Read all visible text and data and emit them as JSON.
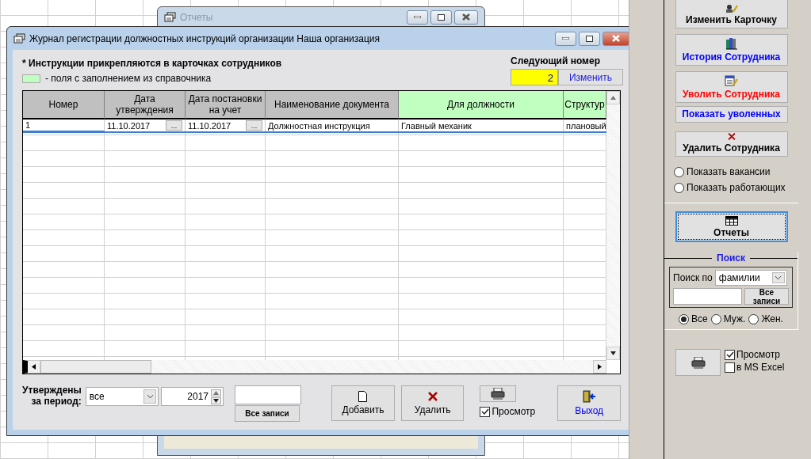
{
  "background_window": {
    "title": "Отчеты"
  },
  "window": {
    "title": "Журнал регистрации должностных инструкций организации  Наша организация",
    "note": "* Инструкции прикрепляются в карточках сотрудников",
    "legend": "- поля с заполнением из справочника",
    "next_number": {
      "label": "Следующий номер",
      "value": "2",
      "button": "Изменить"
    },
    "table": {
      "columns": [
        {
          "label": "Номер",
          "lookup": false
        },
        {
          "label": "Дата утверждения",
          "lookup": false
        },
        {
          "label": "Дата постановки на учет",
          "lookup": false
        },
        {
          "label": "Наименование документа",
          "lookup": false
        },
        {
          "label": "Для должности",
          "lookup": true
        },
        {
          "label": "Структур",
          "lookup": true
        }
      ],
      "rows": [
        {
          "selected": true,
          "cells": [
            {
              "kind": "text",
              "value": "1"
            },
            {
              "kind": "date",
              "value": "11.10.2017",
              "picker": "..."
            },
            {
              "kind": "date",
              "value": "11.10.2017",
              "picker": "..."
            },
            {
              "kind": "text",
              "value": "Должностная инструкция"
            },
            {
              "kind": "text",
              "value": "Главный механик"
            },
            {
              "kind": "text",
              "value": "плановый"
            }
          ]
        }
      ]
    },
    "filter": {
      "label": "Утверждены за период:",
      "period": "все",
      "year": "2017",
      "all_button": "Все записи"
    },
    "buttons": [
      {
        "kind": "add",
        "label": "Добавить"
      },
      {
        "kind": "delete",
        "label": "Удалить"
      },
      {
        "kind": "print",
        "preview": {
          "label": "Просмотр",
          "checked": true
        }
      },
      {
        "kind": "exit",
        "label": "Выход"
      }
    ]
  },
  "sidebar": {
    "buttons": [
      {
        "kind": "edit",
        "label": "Изменить Карточку",
        "color": "#000000"
      },
      {
        "kind": "history",
        "label": "История Сотрудника",
        "color": "#0000ff"
      },
      {
        "kind": "dismiss",
        "label": "Уволить Сотрудника",
        "color": "#ff0000"
      },
      {
        "kind": "plain",
        "label": "Показать уволенных",
        "color": "#0000ff"
      },
      {
        "kind": "delete",
        "label": "Удалить Сотрудника",
        "color": "#000000"
      }
    ],
    "view_filters": [
      {
        "label": "Показать вакансии",
        "selected": false
      },
      {
        "label": "Показать работающих",
        "selected": false
      }
    ],
    "reports_button": {
      "label": "Отчеты",
      "focused": true
    },
    "search": {
      "title": "Поиск",
      "by_label": "Поиск по",
      "by_value": "фамилии",
      "all_button": "Все записи",
      "gender": [
        {
          "label": "Все",
          "selected": true
        },
        {
          "label": "Муж.",
          "selected": false
        },
        {
          "label": "Жен.",
          "selected": false
        }
      ]
    },
    "print": {
      "options": [
        {
          "label": "Просмотр",
          "checked": true
        },
        {
          "label": "в MS Excel",
          "checked": false
        }
      ]
    }
  }
}
